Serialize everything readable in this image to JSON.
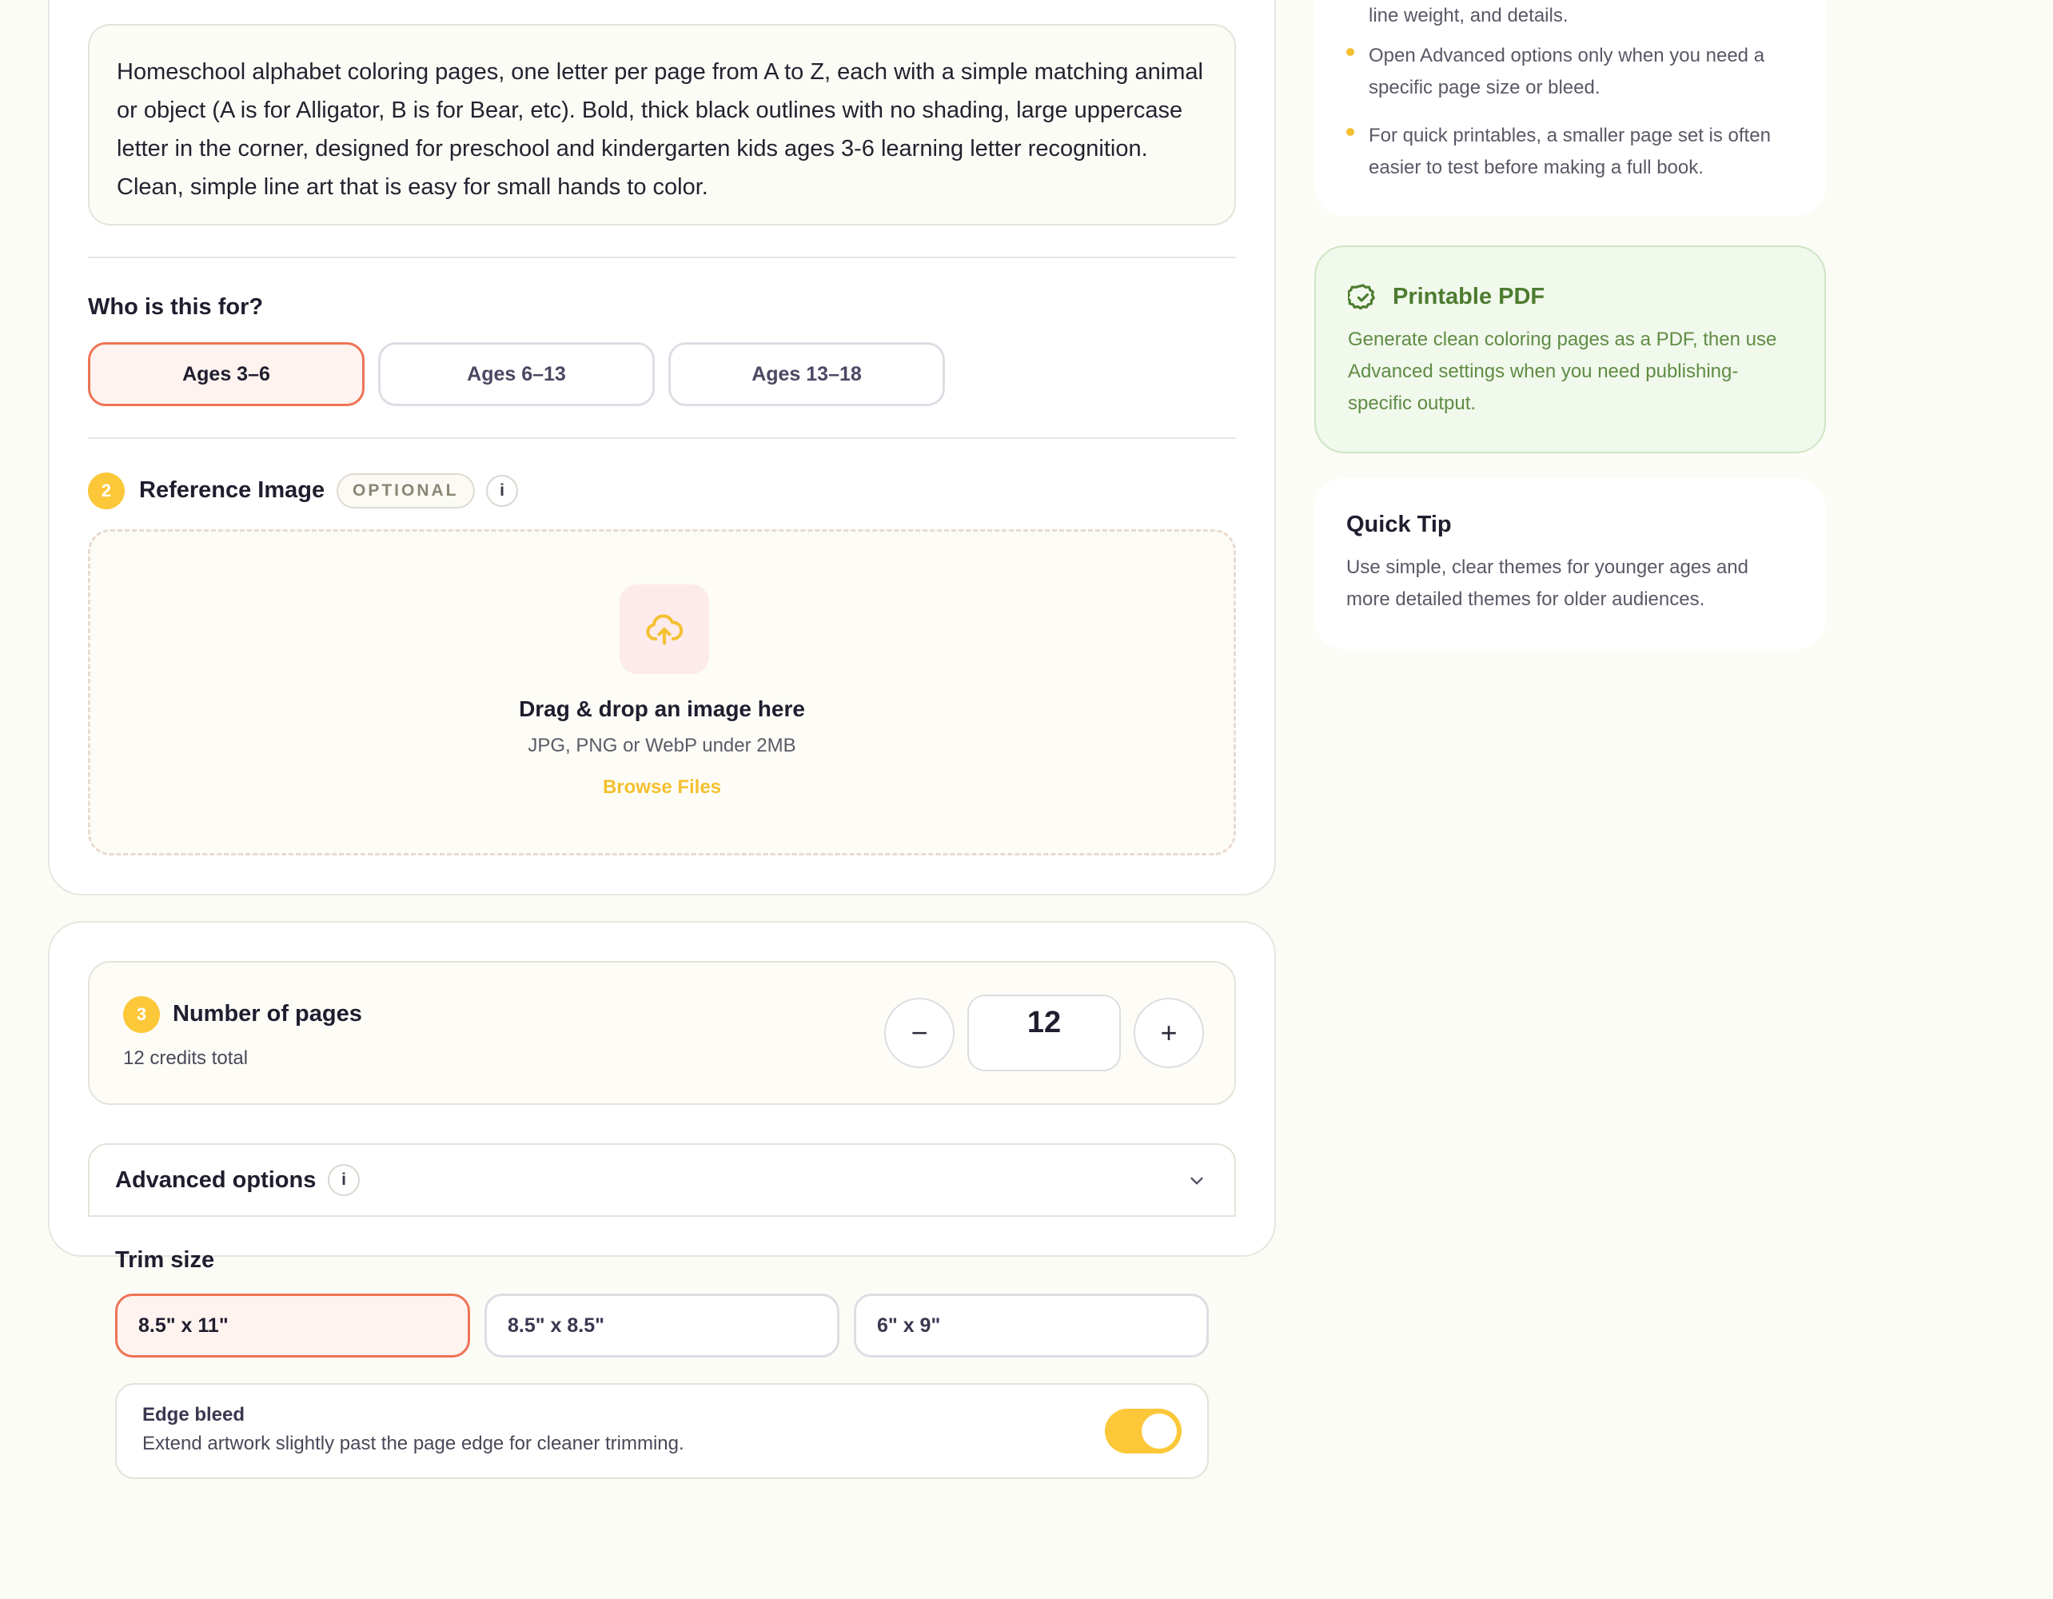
{
  "prompt": {
    "text": "Homeschool alphabet coloring pages, one letter per page from A to Z, each with a simple matching animal or object (A is for Alligator, B is for Bear, etc). Bold, thick black outlines with no shading, large uppercase letter in the corner, designed for preschool and kindergarten kids ages 3-6 learning letter recognition. Clean, simple line art that is easy for small hands to color."
  },
  "audience": {
    "heading": "Who is this for?",
    "options": [
      {
        "label": "Ages 3–6",
        "selected": true
      },
      {
        "label": "Ages 6–13",
        "selected": false
      },
      {
        "label": "Ages 13–18",
        "selected": false
      }
    ]
  },
  "reference_image": {
    "step": "2",
    "heading": "Reference Image",
    "badge": "OPTIONAL",
    "info": "i",
    "drop_title": "Drag & drop an image here",
    "drop_subtitle": "JPG, PNG or WebP under 2MB",
    "browse_label": "Browse Files",
    "icon": "cloud-upload-icon"
  },
  "pages": {
    "step": "3",
    "heading": "Number of pages",
    "credits": "12 credits total",
    "value": "12",
    "minus": "−",
    "plus": "+"
  },
  "advanced": {
    "heading": "Advanced options",
    "info": "i",
    "trim_heading": "Trim size",
    "trim_options": [
      {
        "label": "8.5\" x 11\"",
        "selected": true
      },
      {
        "label": "8.5\" x 8.5\"",
        "selected": false
      },
      {
        "label": "6\" x 9\"",
        "selected": false
      }
    ],
    "bleed_title": "Edge bleed",
    "bleed_desc": "Extend artwork slightly past the page edge for cleaner trimming.",
    "bleed_on": true
  },
  "sidebar": {
    "tips": [
      "line weight, and details.",
      "Open Advanced options only when you need a specific page size or bleed.",
      "For quick printables, a smaller page set is often easier to test before making a full book."
    ],
    "pdf_title": "Printable PDF",
    "pdf_body": "Generate clean coloring pages as a PDF, then use Advanced settings when you need publishing-specific output.",
    "tip_title": "Quick Tip",
    "tip_body": "Use simple, clear themes for younger ages and more detailed themes for older audiences."
  },
  "colors": {
    "accent": "#fcc738",
    "selected_border": "#ee7355",
    "success": "#4d7c2f",
    "background": "#fcfcf7"
  }
}
